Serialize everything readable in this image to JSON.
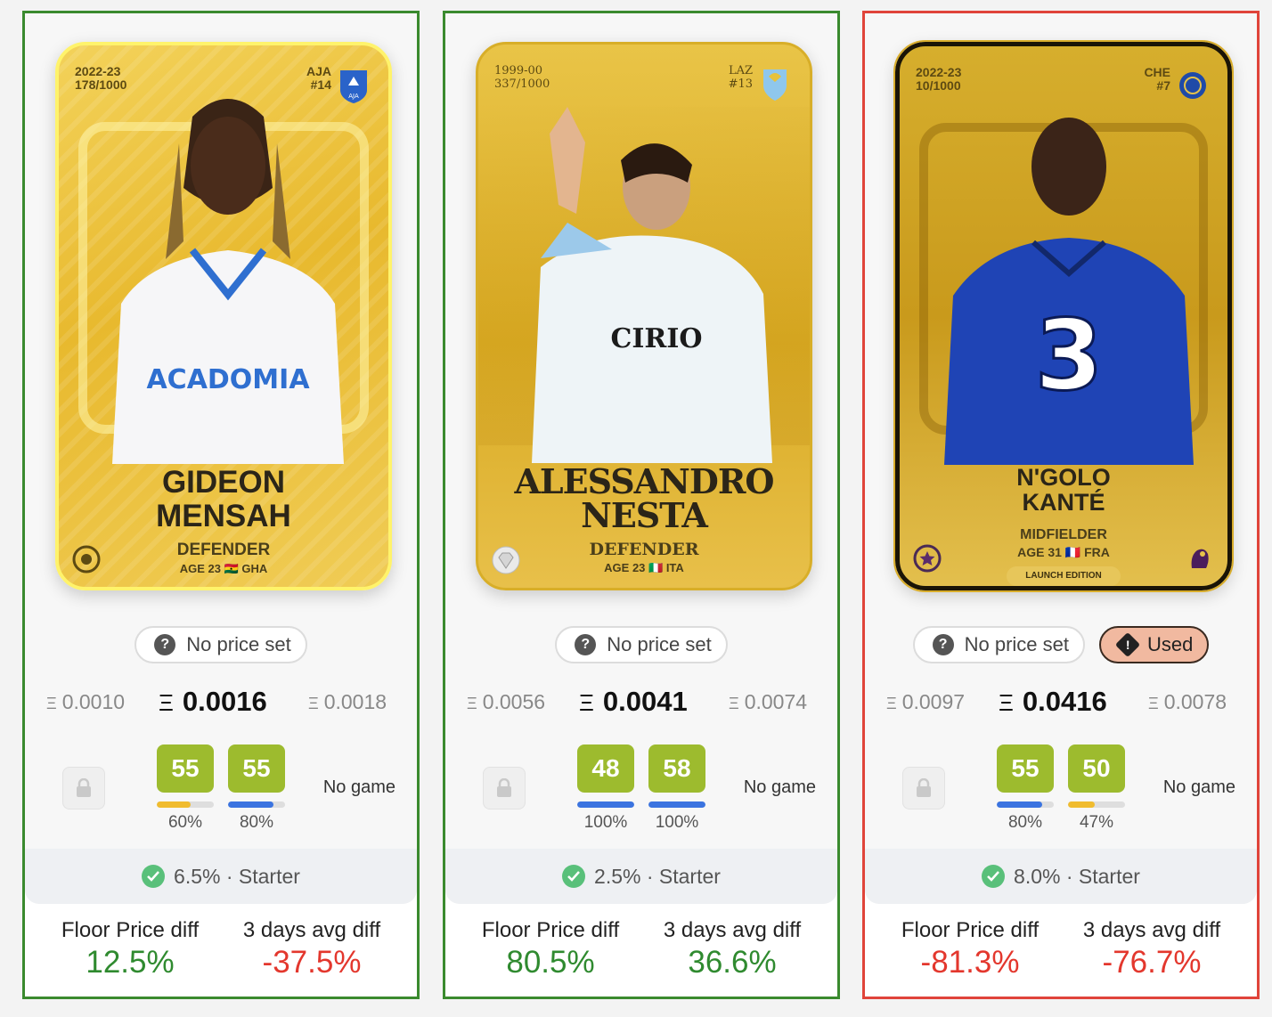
{
  "cards": [
    {
      "season": "2022-23",
      "serial": "178/1000",
      "club": "AJA",
      "number": "#14",
      "name_line1": "GIDEON",
      "name_line2": "MENSAH",
      "position": "DEFENDER",
      "age_nat": "AGE 23 🇬🇭 GHA",
      "edition": "",
      "no_price_label": "No price set",
      "used_label": "",
      "price_low": "0.0010",
      "price_main": "0.0016",
      "price_high": "0.0018",
      "score1": "55",
      "score1_pct": "60%",
      "score1_level": 0.6,
      "score1_color": "#f0bc2f",
      "score2": "55",
      "score2_pct": "80%",
      "score2_level": 0.8,
      "score2_color": "#3b74e0",
      "game_status": "No game",
      "starter_text": "6.5% · Starter",
      "floor_label": "Floor Price diff",
      "floor_value": "12.5%",
      "avg_label": "3 days avg diff",
      "avg_value": "-37.5%",
      "border": "green"
    },
    {
      "season": "1999-00",
      "serial": "337/1000",
      "club": "LAZ",
      "number": "#13",
      "name_line1": "ALESSANDRO",
      "name_line2": "NESTA",
      "position": "DEFENDER",
      "age_nat": "AGE 23 🇮🇹 ITA",
      "edition": "",
      "no_price_label": "No price set",
      "used_label": "",
      "price_low": "0.0056",
      "price_main": "0.0041",
      "price_high": "0.0074",
      "score1": "48",
      "score1_pct": "100%",
      "score1_level": 1.0,
      "score1_color": "#3b74e0",
      "score2": "58",
      "score2_pct": "100%",
      "score2_level": 1.0,
      "score2_color": "#3b74e0",
      "game_status": "No game",
      "starter_text": "2.5% · Starter",
      "floor_label": "Floor Price diff",
      "floor_value": "80.5%",
      "avg_label": "3 days avg diff",
      "avg_value": "36.6%",
      "border": "green"
    },
    {
      "season": "2022-23",
      "serial": "10/1000",
      "club": "CHE",
      "number": "#7",
      "name_line1": "N'GOLO",
      "name_line2": "KANTÉ",
      "position": "MIDFIELDER",
      "age_nat": "AGE 31 🇫🇷 FRA",
      "edition": "LAUNCH EDITION",
      "no_price_label": "No price set",
      "used_label": "Used",
      "price_low": "0.0097",
      "price_main": "0.0416",
      "price_high": "0.0078",
      "score1": "55",
      "score1_pct": "80%",
      "score1_level": 0.8,
      "score1_color": "#3b74e0",
      "score2": "50",
      "score2_pct": "47%",
      "score2_level": 0.47,
      "score2_color": "#f0bc2f",
      "game_status": "No game",
      "starter_text": "8.0% · Starter",
      "floor_label": "Floor Price diff",
      "floor_value": "-81.3%",
      "avg_label": "3 days avg diff",
      "avg_value": "-76.7%",
      "border": "red"
    }
  ],
  "currency_symbol": "Ξ",
  "colors": {
    "positive": "#2f8a2f",
    "negative": "#e3372d",
    "score_box": "#9dbb2e",
    "used_badge": "#f1b9a0"
  }
}
